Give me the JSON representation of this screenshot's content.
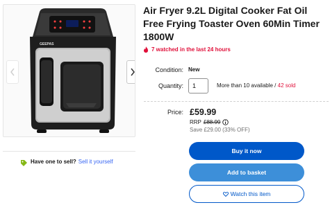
{
  "listing": {
    "title": "Air Fryer 9.2L Digital Cooker Fat Oil Free Frying Toaster Oven 60Min Timer 1800W",
    "watched": "7 watched in the last 24 hours",
    "condition_label": "Condition:",
    "condition_value": "New",
    "quantity_label": "Quantity:",
    "quantity_value": "1",
    "availability": "More than 10 available",
    "availability_sep": " / ",
    "sold": "42 sold",
    "price_label": "Price:",
    "price": "£59.99",
    "rrp_label": "RRP",
    "rrp_value": "£88.99",
    "save_text": "Save £29.00 (33% OFF)"
  },
  "actions": {
    "buy_now": "Buy it now",
    "add_to_basket": "Add to basket",
    "watch": "Watch this item"
  },
  "sell": {
    "prompt": "Have one to sell?",
    "link": "Sell it yourself"
  },
  "gallery": {
    "brand_text": "GEEPAS",
    "prev_icon": "chevron-left-icon",
    "next_icon": "chevron-right-icon"
  },
  "colors": {
    "accent_blue": "#0058c9",
    "basket_blue": "#3d8fd9",
    "alert_red": "#e0103a",
    "link_blue": "#3665f3"
  }
}
